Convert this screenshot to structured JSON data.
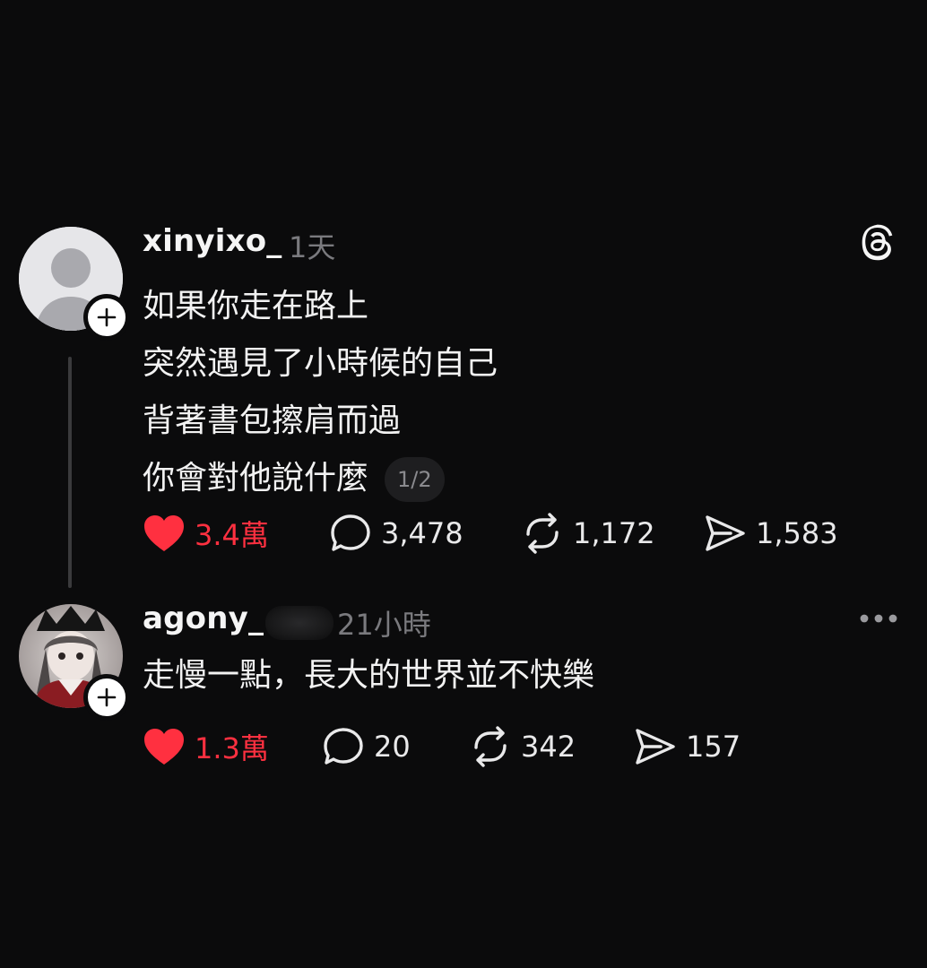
{
  "post": {
    "username": "xinyixo_",
    "time": "1天",
    "lines": [
      "如果你走在路上",
      "突然遇見了小時候的自己",
      "背著書包擦肩而過",
      "你會對他說什麼"
    ],
    "page_indicator": "1/2",
    "likes": "3.4萬",
    "comments": "3,478",
    "reposts": "1,172",
    "shares": "1,583"
  },
  "reply": {
    "username": "agony_",
    "time": "21小時",
    "text": "走慢一點，長大的世界並不快樂",
    "likes": "1.3萬",
    "comments": "20",
    "reposts": "342",
    "shares": "157"
  },
  "icons": {
    "app_logo": "threads-logo-icon",
    "follow": "plus-icon",
    "like": "heart-icon",
    "comment": "speech-bubble-icon",
    "repost": "repost-icon",
    "share": "paper-plane-icon",
    "more": "ellipsis-icon"
  },
  "colors": {
    "background": "#0b0b0c",
    "liked": "#ff3040",
    "secondary_text": "#7a7a7e"
  }
}
